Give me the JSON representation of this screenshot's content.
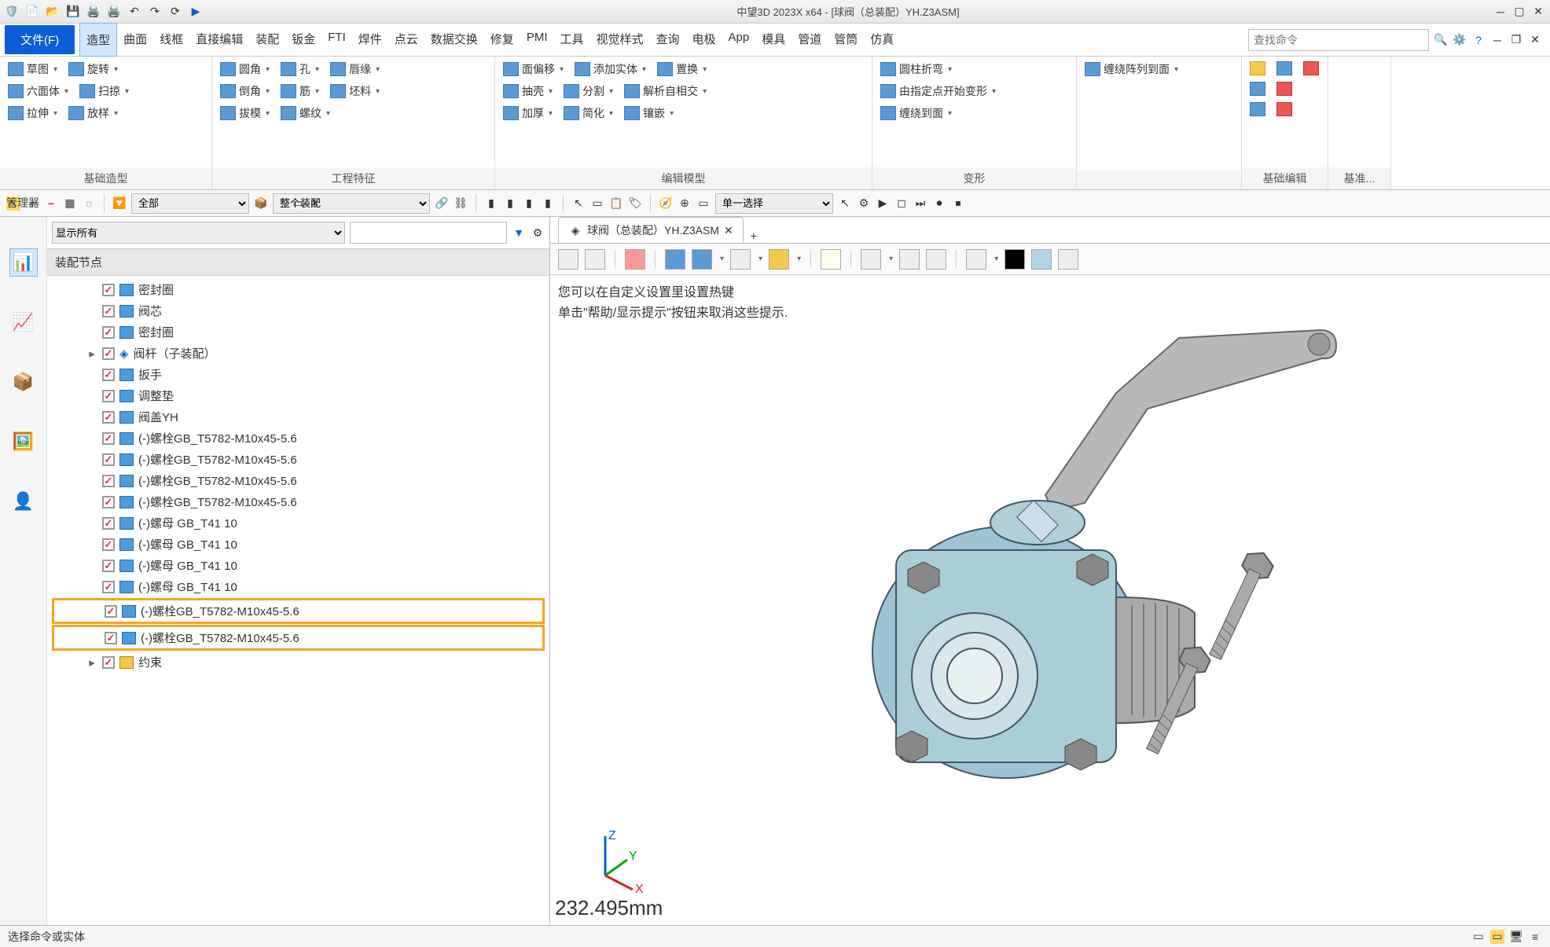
{
  "title": "中望3D 2023X x64 - [球阀（总装配）YH.Z3ASM]",
  "fileBtn": "文件(F)",
  "menus": [
    "造型",
    "曲面",
    "线框",
    "直接编辑",
    "装配",
    "钣金",
    "FTI",
    "焊件",
    "点云",
    "数据交换",
    "修复",
    "PMI",
    "工具",
    "视觉样式",
    "查询",
    "电极",
    "App",
    "模具",
    "管道",
    "管筒",
    "仿真"
  ],
  "searchPlaceholder": "查找命令",
  "ribbon": {
    "g1": {
      "label": "基础造型",
      "rows": [
        [
          "草图",
          "旋转"
        ],
        [
          "六面体",
          "扫掠"
        ],
        [
          "拉伸",
          "放样"
        ]
      ]
    },
    "g2": {
      "label": "工程特征",
      "rows": [
        [
          "圆角",
          "孔",
          "唇缘"
        ],
        [
          "倒角",
          "筋",
          "坯料"
        ],
        [
          "拔模",
          "螺纹"
        ]
      ]
    },
    "g3": {
      "label": "编辑模型",
      "rows": [
        [
          "面偏移",
          "添加实体",
          "置换"
        ],
        [
          "抽壳",
          "分割",
          "解析自相交"
        ],
        [
          "加厚",
          "简化",
          "镶嵌"
        ]
      ]
    },
    "g4": {
      "label": "变形",
      "rows": [
        [
          "圆柱折弯"
        ],
        [
          "由指定点开始变形"
        ],
        [
          "缠绕到面"
        ]
      ]
    },
    "g5": {
      "label": "",
      "rows": [
        [
          "缠绕阵列到面"
        ]
      ]
    },
    "g6": {
      "label": "基础编辑"
    },
    "g7": {
      "label": "基准..."
    }
  },
  "quickbar": {
    "sel1": "全部",
    "sel2": "整个装配",
    "sel3": "单一选择"
  },
  "manager": "管理器",
  "leftPanel": {
    "showAll": "显示所有",
    "header": "装配节点",
    "items": [
      {
        "name": "密封圈"
      },
      {
        "name": "阀芯"
      },
      {
        "name": "密封圈"
      },
      {
        "name": "阀杆（子装配）",
        "exp": true,
        "asm": true
      },
      {
        "name": "扳手"
      },
      {
        "name": "调整垫"
      },
      {
        "name": "阀盖YH"
      },
      {
        "name": "(-)螺栓GB_T5782-M10x45-5.6"
      },
      {
        "name": "(-)螺栓GB_T5782-M10x45-5.6"
      },
      {
        "name": "(-)螺栓GB_T5782-M10x45-5.6"
      },
      {
        "name": "(-)螺栓GB_T5782-M10x45-5.6"
      },
      {
        "name": "(-)螺母 GB_T41 10"
      },
      {
        "name": "(-)螺母 GB_T41 10"
      },
      {
        "name": "(-)螺母 GB_T41 10"
      },
      {
        "name": "(-)螺母 GB_T41 10"
      },
      {
        "name": "(-)螺栓GB_T5782-M10x45-5.6",
        "hl": true
      },
      {
        "name": "(-)螺栓GB_T5782-M10x45-5.6",
        "hl": true
      },
      {
        "name": "约束",
        "exp": true,
        "folder": true
      }
    ]
  },
  "docTab": "球阀（总装配）YH.Z3ASM",
  "hint1": "您可以在自定义设置里设置热键",
  "hint2": "单击\"帮助/显示提示\"按钮来取消这些提示.",
  "dimension": "232.495mm",
  "status": "选择命令或实体",
  "axis": {
    "x": "X",
    "y": "Y",
    "z": "Z"
  }
}
